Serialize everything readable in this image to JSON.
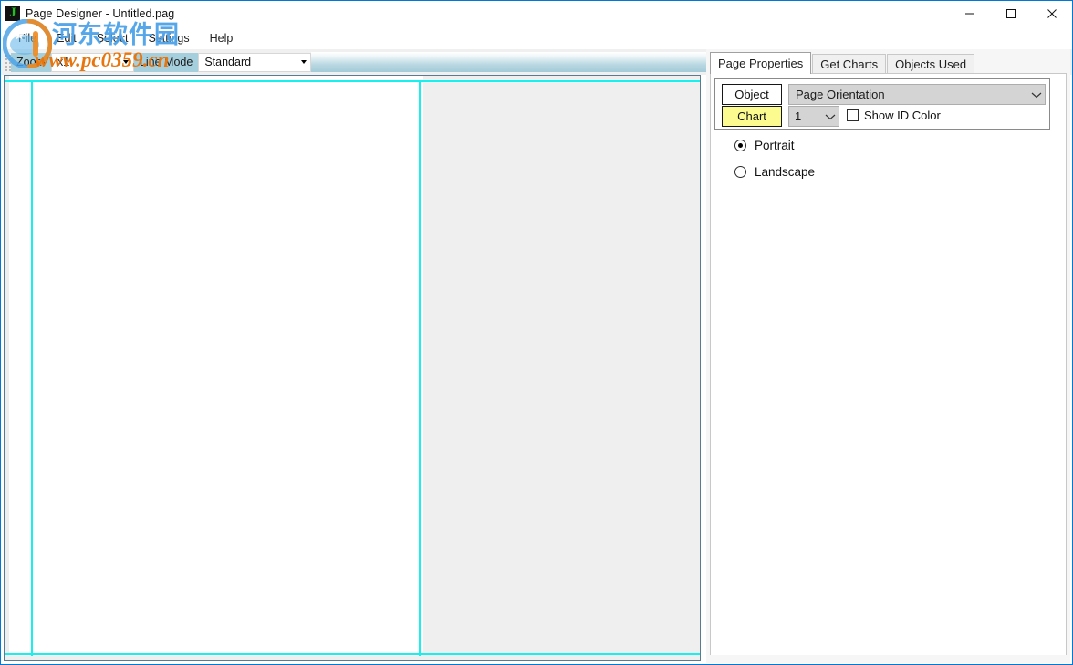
{
  "window": {
    "title": "Page Designer - Untitled.pag",
    "app_icon": "app-letter-j-icon",
    "minimize": "─",
    "maximize": "□",
    "close": "✕"
  },
  "menubar": {
    "items": [
      {
        "label": "File"
      },
      {
        "label": "Edit"
      },
      {
        "label": "Select"
      },
      {
        "label": "Settings"
      },
      {
        "label": "Help"
      }
    ]
  },
  "toolbar": {
    "zoom_label": "Zoom",
    "zoom_value": "x1",
    "zoom_options": [
      "x1"
    ],
    "linemode_label": "Line Mode",
    "linemode_value": "Standard",
    "linemode_options": [
      "Standard"
    ],
    "gradient_colors": [
      "#ffffff",
      "#a3cbd8"
    ]
  },
  "canvas": {
    "page_background": "#ffffff",
    "workspace_background": "#efefef",
    "guide_color": "#18efef"
  },
  "right_panel": {
    "tabs": [
      {
        "label": "Page Properties",
        "active": true
      },
      {
        "label": "Get Charts",
        "active": false
      },
      {
        "label": "Objects Used",
        "active": false
      }
    ],
    "object_button": "Object",
    "chart_button": "Chart",
    "chart_button_color": "#fbfb90",
    "orientation_combo_value": "Page Orientation",
    "orientation_combo_options": [
      "Page Orientation"
    ],
    "id_combo_value": "1",
    "id_combo_options": [
      "1"
    ],
    "show_id_color_label": "Show ID Color",
    "show_id_color_checked": false,
    "orientation_options": [
      {
        "label": "Portrait",
        "selected": true
      },
      {
        "label": "Landscape",
        "selected": false
      }
    ]
  },
  "watermark": {
    "chinese_text": "河东软件园",
    "url_text": "www.pc0359.cn",
    "logo_name": "site-logo-watermark"
  }
}
